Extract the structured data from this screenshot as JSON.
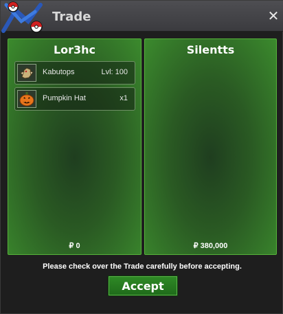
{
  "window": {
    "title": "Trade",
    "close_symbol": "✕",
    "logo_icon": "pokeball-swap-logo"
  },
  "left_panel": {
    "player_name": "Lor3hc",
    "items": [
      {
        "name": "Kabutops",
        "detail": "Lvl: 100",
        "icon": "kabutops-icon"
      },
      {
        "name": "Pumpkin Hat",
        "detail": "x1",
        "icon": "pumpkin-icon"
      }
    ],
    "money": "₽ 0"
  },
  "right_panel": {
    "player_name": "Silentts",
    "items": [],
    "money": "₽ 380,000"
  },
  "footer": {
    "notice": "Please check over the Trade carefully before accepting.",
    "accept_label": "Accept"
  },
  "colors": {
    "panel_border": "#56b43a",
    "panel_green": "#3b8a2d",
    "accept_button": "#2f8a26",
    "title_bar": "#4e4e52"
  }
}
